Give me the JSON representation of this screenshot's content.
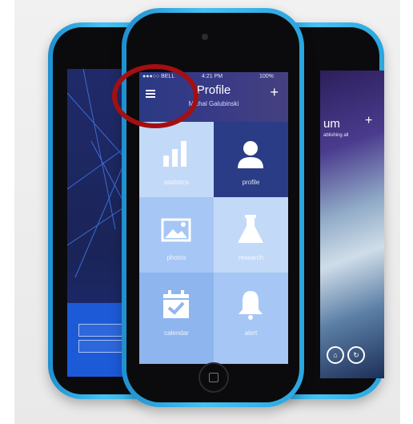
{
  "center_phone": {
    "statusbar": {
      "carrier": "●●●○○ BELL",
      "time": "4:21 PM",
      "battery": "100%"
    },
    "header": {
      "title": "Profile",
      "subtitle": "Michal Galubinski",
      "menu_icon": "hamburger-menu-icon",
      "add_icon": "plus-icon"
    },
    "tiles": [
      {
        "label": "statistics",
        "icon": "bar-chart-icon",
        "color": "#c3d9f8"
      },
      {
        "label": "profile",
        "icon": "user-icon",
        "color": "#2b3c87"
      },
      {
        "label": "photos",
        "icon": "image-icon",
        "color": "#a6c6f5"
      },
      {
        "label": "research",
        "icon": "flask-icon",
        "color": "#c3d9f8"
      },
      {
        "label": "calendar",
        "icon": "calendar-check-icon",
        "color": "#8fb5ef"
      },
      {
        "label": "alert",
        "icon": "bell-icon",
        "color": "#a6c6f5"
      }
    ]
  },
  "right_phone": {
    "title_fragment": "um",
    "subtitle_fragment": "ablishing all"
  },
  "highlight": {
    "color": "#a40f12",
    "target": "hamburger-menu-icon"
  }
}
